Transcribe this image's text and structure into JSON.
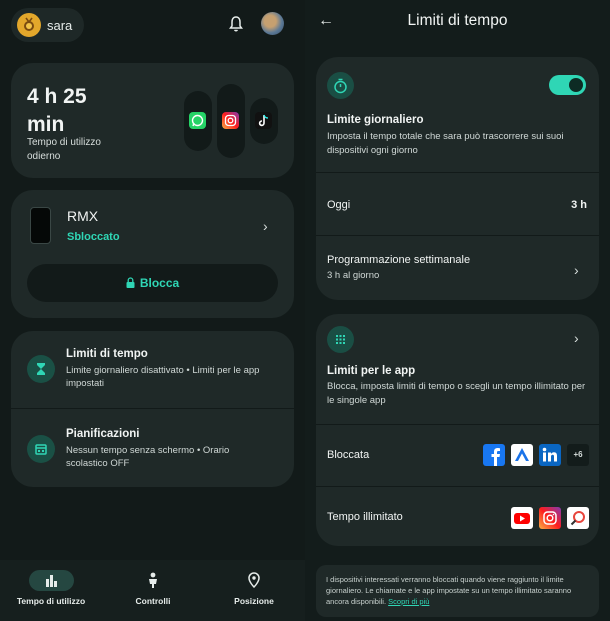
{
  "user": {
    "name": "sara"
  },
  "usage": {
    "time_line1": "4 h 25",
    "time_line2": "min",
    "caption": "Tempo di utilizzo odierno",
    "apps": [
      "whatsapp-icon",
      "instagram-icon",
      "tiktok-icon"
    ]
  },
  "device": {
    "name": "RMX",
    "status": "Sbloccato",
    "block_label": "Blocca"
  },
  "settings_rows": [
    {
      "title": "Limiti di tempo",
      "desc": "Limite giornaliero disattivato • Limiti per le app impostati"
    },
    {
      "title": "Pianificazioni",
      "desc": "Nessun tempo senza schermo • Orario scolastico OFF"
    }
  ],
  "bottom_nav": [
    {
      "label": "Tempo di utilizzo",
      "icon": "bar-chart-icon",
      "active": true
    },
    {
      "label": "Controlli",
      "icon": "child-icon",
      "active": false
    },
    {
      "label": "Posizione",
      "icon": "location-pin-icon",
      "active": false
    }
  ],
  "detail": {
    "title": "Limiti di tempo",
    "daily_limit": {
      "title": "Limite giornaliero",
      "desc": "Imposta il tempo totale che sara può trascorrere sui suoi dispositivi ogni giorno",
      "enabled": true
    },
    "today": {
      "label": "Oggi",
      "value": "3 h"
    },
    "weekly": {
      "title": "Programmazione settimanale",
      "desc": "3 h al giorno"
    },
    "app_limits": {
      "title": "Limiti per le app",
      "desc": "Blocca, imposta limiti di tempo o scegli un tempo illimitato per le singole app"
    },
    "blocked": {
      "label": "Bloccata",
      "more": "+6"
    },
    "unlimited": {
      "label": "Tempo illimitato"
    },
    "footer": {
      "text": "I dispositivi interessati verranno bloccati quando viene raggiunto il limite giornaliero. Le chiamate e le app impostate su un tempo illimitato saranno ancora disponibili.",
      "link": "Scopri di più"
    }
  },
  "colors": {
    "background": "#121a19",
    "card": "#1f2928",
    "accent": "#2fd6b5"
  }
}
